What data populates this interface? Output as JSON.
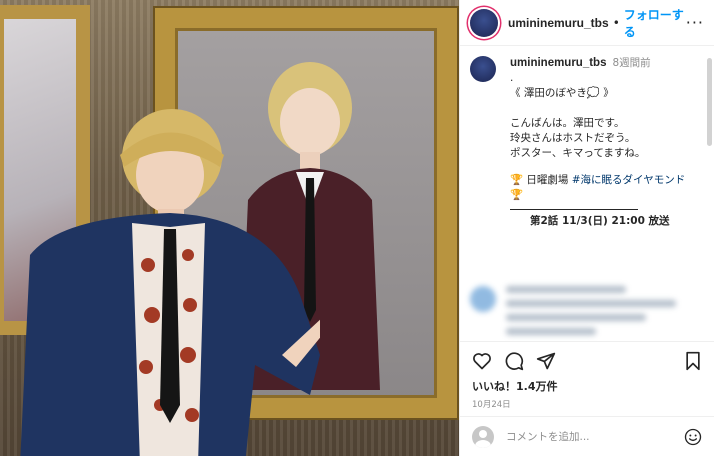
{
  "post": {
    "username": "umininemuru_tbs",
    "separator": "•",
    "follow_label": "フォローする",
    "more_label": "···"
  },
  "caption": {
    "username": "umininemuru_tbs",
    "time": "8週間前",
    "lines": [
      ".",
      "《 澤田のぼやき💭 》",
      "",
      "こんばんは。澤田です。",
      "玲央さんはホストだぞう。",
      "ポスター、キマってますね。",
      ""
    ],
    "show_prefix": "🏆 日曜劇場 ",
    "show_tag": "#海に眠るダイヤモンド",
    "show_suffix": "🏆",
    "episode_line": "第2話 11/3(日) 21:00 放送"
  },
  "stats": {
    "likes": "いいね！1.4万件",
    "date": "10月24日"
  },
  "comment": {
    "placeholder": "コメントを追加..."
  },
  "icons": {
    "like": "heart-icon",
    "comment": "comment-icon",
    "share": "share-icon",
    "save": "bookmark-icon",
    "emoji": "emoji-icon"
  },
  "colors": {
    "follow": "#0095f6",
    "hashtag": "#00376b",
    "story_ring": "#e1306c"
  }
}
